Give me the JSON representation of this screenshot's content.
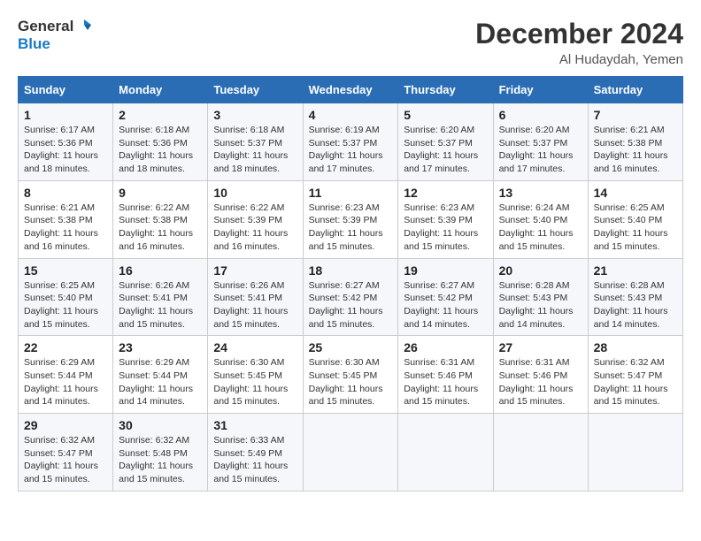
{
  "logo": {
    "line1": "General",
    "line2": "Blue"
  },
  "title": "December 2024",
  "location": "Al Hudaydah, Yemen",
  "days_of_week": [
    "Sunday",
    "Monday",
    "Tuesday",
    "Wednesday",
    "Thursday",
    "Friday",
    "Saturday"
  ],
  "weeks": [
    [
      {
        "day": "1",
        "sunrise": "Sunrise: 6:17 AM",
        "sunset": "Sunset: 5:36 PM",
        "daylight": "Daylight: 11 hours and 18 minutes."
      },
      {
        "day": "2",
        "sunrise": "Sunrise: 6:18 AM",
        "sunset": "Sunset: 5:36 PM",
        "daylight": "Daylight: 11 hours and 18 minutes."
      },
      {
        "day": "3",
        "sunrise": "Sunrise: 6:18 AM",
        "sunset": "Sunset: 5:37 PM",
        "daylight": "Daylight: 11 hours and 18 minutes."
      },
      {
        "day": "4",
        "sunrise": "Sunrise: 6:19 AM",
        "sunset": "Sunset: 5:37 PM",
        "daylight": "Daylight: 11 hours and 17 minutes."
      },
      {
        "day": "5",
        "sunrise": "Sunrise: 6:20 AM",
        "sunset": "Sunset: 5:37 PM",
        "daylight": "Daylight: 11 hours and 17 minutes."
      },
      {
        "day": "6",
        "sunrise": "Sunrise: 6:20 AM",
        "sunset": "Sunset: 5:37 PM",
        "daylight": "Daylight: 11 hours and 17 minutes."
      },
      {
        "day": "7",
        "sunrise": "Sunrise: 6:21 AM",
        "sunset": "Sunset: 5:38 PM",
        "daylight": "Daylight: 11 hours and 16 minutes."
      }
    ],
    [
      {
        "day": "8",
        "sunrise": "Sunrise: 6:21 AM",
        "sunset": "Sunset: 5:38 PM",
        "daylight": "Daylight: 11 hours and 16 minutes."
      },
      {
        "day": "9",
        "sunrise": "Sunrise: 6:22 AM",
        "sunset": "Sunset: 5:38 PM",
        "daylight": "Daylight: 11 hours and 16 minutes."
      },
      {
        "day": "10",
        "sunrise": "Sunrise: 6:22 AM",
        "sunset": "Sunset: 5:39 PM",
        "daylight": "Daylight: 11 hours and 16 minutes."
      },
      {
        "day": "11",
        "sunrise": "Sunrise: 6:23 AM",
        "sunset": "Sunset: 5:39 PM",
        "daylight": "Daylight: 11 hours and 15 minutes."
      },
      {
        "day": "12",
        "sunrise": "Sunrise: 6:23 AM",
        "sunset": "Sunset: 5:39 PM",
        "daylight": "Daylight: 11 hours and 15 minutes."
      },
      {
        "day": "13",
        "sunrise": "Sunrise: 6:24 AM",
        "sunset": "Sunset: 5:40 PM",
        "daylight": "Daylight: 11 hours and 15 minutes."
      },
      {
        "day": "14",
        "sunrise": "Sunrise: 6:25 AM",
        "sunset": "Sunset: 5:40 PM",
        "daylight": "Daylight: 11 hours and 15 minutes."
      }
    ],
    [
      {
        "day": "15",
        "sunrise": "Sunrise: 6:25 AM",
        "sunset": "Sunset: 5:40 PM",
        "daylight": "Daylight: 11 hours and 15 minutes."
      },
      {
        "day": "16",
        "sunrise": "Sunrise: 6:26 AM",
        "sunset": "Sunset: 5:41 PM",
        "daylight": "Daylight: 11 hours and 15 minutes."
      },
      {
        "day": "17",
        "sunrise": "Sunrise: 6:26 AM",
        "sunset": "Sunset: 5:41 PM",
        "daylight": "Daylight: 11 hours and 15 minutes."
      },
      {
        "day": "18",
        "sunrise": "Sunrise: 6:27 AM",
        "sunset": "Sunset: 5:42 PM",
        "daylight": "Daylight: 11 hours and 15 minutes."
      },
      {
        "day": "19",
        "sunrise": "Sunrise: 6:27 AM",
        "sunset": "Sunset: 5:42 PM",
        "daylight": "Daylight: 11 hours and 14 minutes."
      },
      {
        "day": "20",
        "sunrise": "Sunrise: 6:28 AM",
        "sunset": "Sunset: 5:43 PM",
        "daylight": "Daylight: 11 hours and 14 minutes."
      },
      {
        "day": "21",
        "sunrise": "Sunrise: 6:28 AM",
        "sunset": "Sunset: 5:43 PM",
        "daylight": "Daylight: 11 hours and 14 minutes."
      }
    ],
    [
      {
        "day": "22",
        "sunrise": "Sunrise: 6:29 AM",
        "sunset": "Sunset: 5:44 PM",
        "daylight": "Daylight: 11 hours and 14 minutes."
      },
      {
        "day": "23",
        "sunrise": "Sunrise: 6:29 AM",
        "sunset": "Sunset: 5:44 PM",
        "daylight": "Daylight: 11 hours and 14 minutes."
      },
      {
        "day": "24",
        "sunrise": "Sunrise: 6:30 AM",
        "sunset": "Sunset: 5:45 PM",
        "daylight": "Daylight: 11 hours and 15 minutes."
      },
      {
        "day": "25",
        "sunrise": "Sunrise: 6:30 AM",
        "sunset": "Sunset: 5:45 PM",
        "daylight": "Daylight: 11 hours and 15 minutes."
      },
      {
        "day": "26",
        "sunrise": "Sunrise: 6:31 AM",
        "sunset": "Sunset: 5:46 PM",
        "daylight": "Daylight: 11 hours and 15 minutes."
      },
      {
        "day": "27",
        "sunrise": "Sunrise: 6:31 AM",
        "sunset": "Sunset: 5:46 PM",
        "daylight": "Daylight: 11 hours and 15 minutes."
      },
      {
        "day": "28",
        "sunrise": "Sunrise: 6:32 AM",
        "sunset": "Sunset: 5:47 PM",
        "daylight": "Daylight: 11 hours and 15 minutes."
      }
    ],
    [
      {
        "day": "29",
        "sunrise": "Sunrise: 6:32 AM",
        "sunset": "Sunset: 5:47 PM",
        "daylight": "Daylight: 11 hours and 15 minutes."
      },
      {
        "day": "30",
        "sunrise": "Sunrise: 6:32 AM",
        "sunset": "Sunset: 5:48 PM",
        "daylight": "Daylight: 11 hours and 15 minutes."
      },
      {
        "day": "31",
        "sunrise": "Sunrise: 6:33 AM",
        "sunset": "Sunset: 5:49 PM",
        "daylight": "Daylight: 11 hours and 15 minutes."
      },
      null,
      null,
      null,
      null
    ]
  ]
}
